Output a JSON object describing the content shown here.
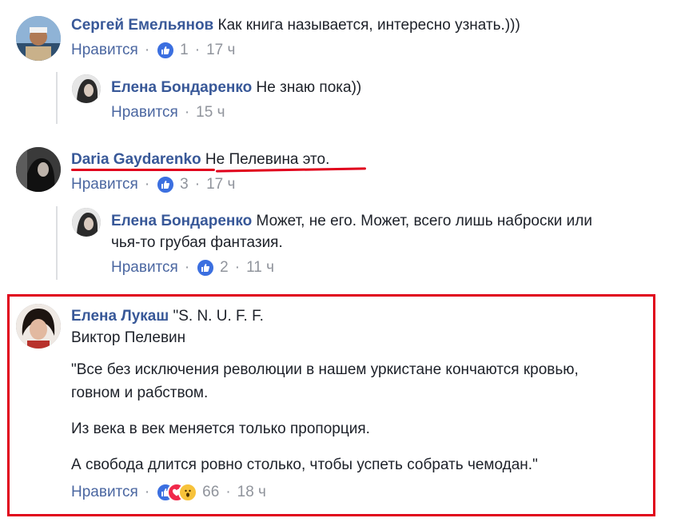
{
  "colors": {
    "author": "#385898",
    "meta": "#90949c",
    "highlight": "#e0001b",
    "like": "#3b6fe0"
  },
  "comments": [
    {
      "author": "Сергей Емельянов",
      "text": "Как книга называется, интересно узнать.)))",
      "like_label": "Нравится",
      "reactions": "1",
      "time": "17 ч",
      "replies": [
        {
          "author": "Елена Бондаренко",
          "text": "Не знаю пока))",
          "like_label": "Нравится",
          "time": "15 ч"
        }
      ]
    },
    {
      "author": "Daria Gaydarenko",
      "text": "Не Пелевина это.",
      "like_label": "Нравится",
      "reactions": "3",
      "time": "17 ч",
      "replies": [
        {
          "author": "Елена Бондаренко",
          "text_line1": "Может, не его. Может, всего лишь наброски или",
          "text_line2": "чья-то грубая фантазия.",
          "like_label": "Нравится",
          "reactions": "2",
          "time": "11 ч"
        }
      ]
    },
    {
      "author": "Елена Лукаш",
      "text_line1": "\"S. N. U. F. F.",
      "text_line2": "Виктор Пелевин",
      "paragraph1_line1": "\"Все без исключения революции в нашем уркистане кончаются кровью,",
      "paragraph1_line2": "говном и рабством.",
      "paragraph2": "Из века в век меняется только пропорция.",
      "paragraph3": "А свобода длится ровно столько, чтобы успеть собрать чемодан.\"",
      "like_label": "Нравится",
      "reactions": "66",
      "time": "18 ч"
    }
  ],
  "separator": "·"
}
